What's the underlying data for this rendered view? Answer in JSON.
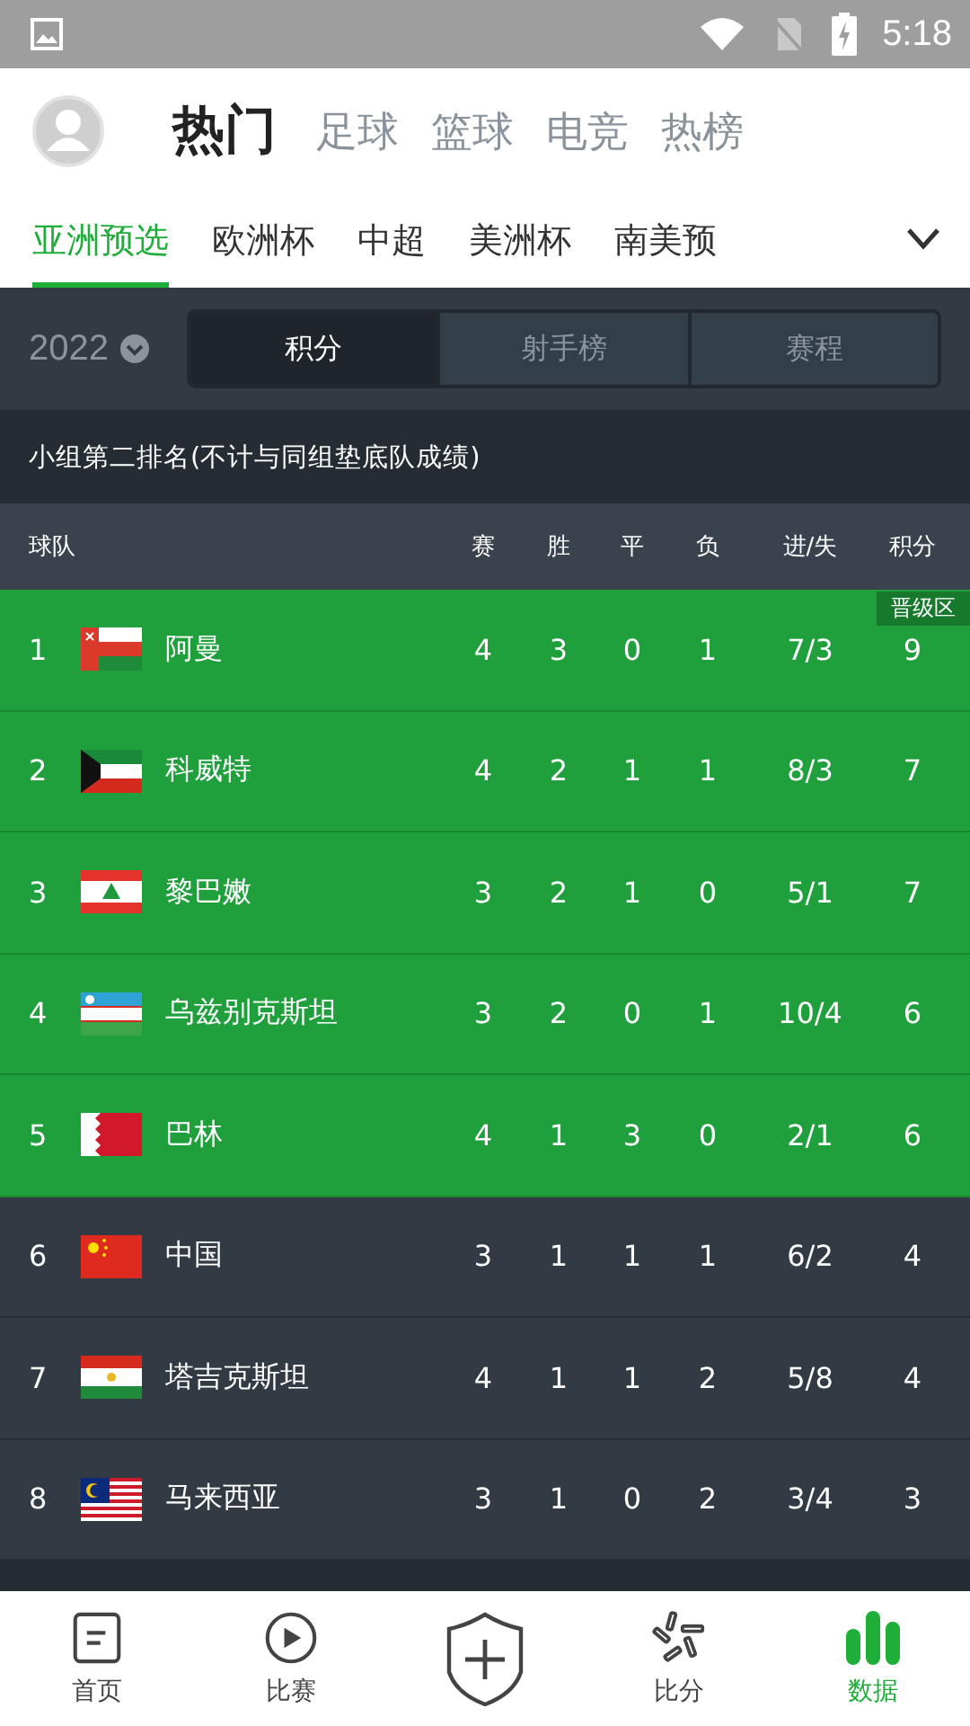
{
  "status_bar": {
    "time": "5:18"
  },
  "top_tabs": [
    {
      "label": "热门",
      "selected": true
    },
    {
      "label": "足球",
      "selected": false
    },
    {
      "label": "篮球",
      "selected": false
    },
    {
      "label": "电竞",
      "selected": false
    },
    {
      "label": "热榜",
      "selected": false
    }
  ],
  "league_tabs": [
    {
      "label": "亚洲预选",
      "selected": true
    },
    {
      "label": "欧洲杯",
      "selected": false
    },
    {
      "label": "中超",
      "selected": false
    },
    {
      "label": "美洲杯",
      "selected": false
    },
    {
      "label": "南美预",
      "selected": false
    }
  ],
  "season": "2022",
  "segments": [
    {
      "label": "积分",
      "selected": true
    },
    {
      "label": "射手榜",
      "selected": false
    },
    {
      "label": "赛程",
      "selected": false
    }
  ],
  "group_title": "小组第二排名(不计与同组垫底队成绩)",
  "table": {
    "columns": [
      "球队",
      "赛",
      "胜",
      "平",
      "负",
      "进/失",
      "积分"
    ],
    "rows": [
      {
        "rank": "1",
        "kind": "oman",
        "team": "阿曼",
        "played": "4",
        "won": "3",
        "drawn": "0",
        "lost": "1",
        "goals": "7/3",
        "points": "9",
        "qualified": true,
        "badge": "晋级区"
      },
      {
        "rank": "2",
        "kind": "kuwait",
        "team": "科威特",
        "played": "4",
        "won": "2",
        "drawn": "1",
        "lost": "1",
        "goals": "8/3",
        "points": "7",
        "qualified": true
      },
      {
        "rank": "3",
        "kind": "lebanon",
        "team": "黎巴嫩",
        "played": "3",
        "won": "2",
        "drawn": "1",
        "lost": "0",
        "goals": "5/1",
        "points": "7",
        "qualified": true
      },
      {
        "rank": "4",
        "kind": "uzbekistan",
        "team": "乌兹别克斯坦",
        "played": "3",
        "won": "2",
        "drawn": "0",
        "lost": "1",
        "goals": "10/4",
        "points": "6",
        "qualified": true
      },
      {
        "rank": "5",
        "kind": "bahrain",
        "team": "巴林",
        "played": "4",
        "won": "1",
        "drawn": "3",
        "lost": "0",
        "goals": "2/1",
        "points": "6",
        "qualified": true
      },
      {
        "rank": "6",
        "kind": "china",
        "team": "中国",
        "played": "3",
        "won": "1",
        "drawn": "1",
        "lost": "1",
        "goals": "6/2",
        "points": "4",
        "qualified": false
      },
      {
        "rank": "7",
        "kind": "tajikistan",
        "team": "塔吉克斯坦",
        "played": "4",
        "won": "1",
        "drawn": "1",
        "lost": "2",
        "goals": "5/8",
        "points": "4",
        "qualified": false
      },
      {
        "rank": "8",
        "kind": "malaysia",
        "team": "马来西亚",
        "played": "3",
        "won": "1",
        "drawn": "0",
        "lost": "2",
        "goals": "3/4",
        "points": "3",
        "qualified": false
      }
    ]
  },
  "bottom_nav": [
    {
      "label": "首页",
      "kind": "home",
      "selected": false
    },
    {
      "label": "比赛",
      "kind": "match",
      "selected": false
    },
    {
      "kind": "center",
      "selected": false
    },
    {
      "label": "比分",
      "kind": "score",
      "selected": false
    },
    {
      "label": "数据",
      "kind": "data",
      "selected": true
    }
  ]
}
